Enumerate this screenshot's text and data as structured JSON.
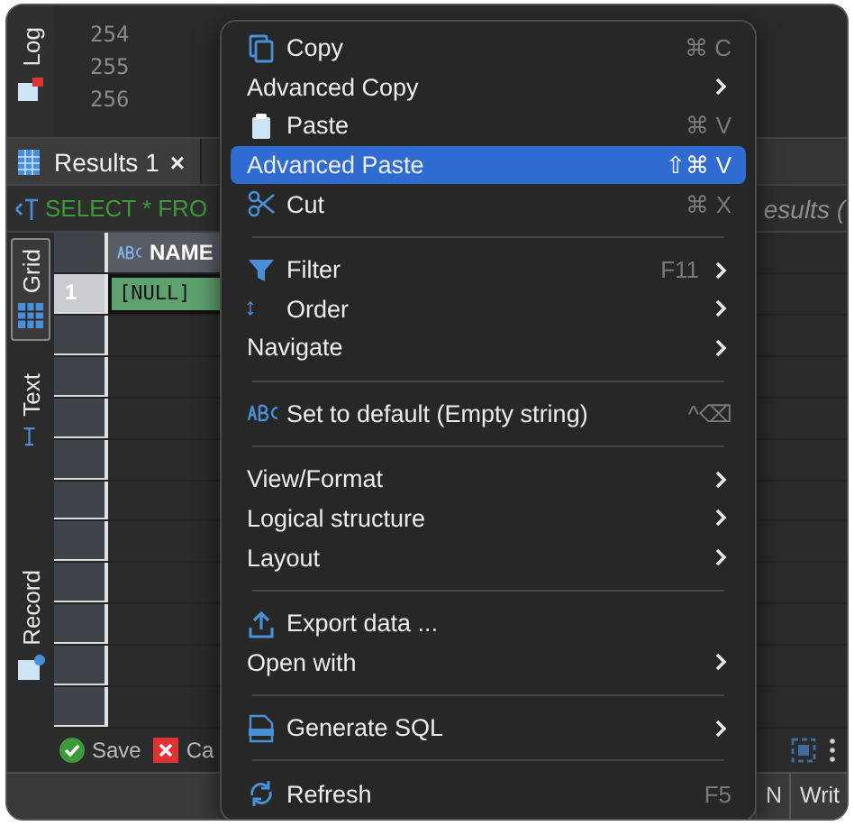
{
  "log_tab": {
    "label": "Log"
  },
  "editor": {
    "line_numbers": [
      "254",
      "255",
      "256"
    ]
  },
  "results_tab": {
    "label": "Results 1",
    "close": "×"
  },
  "query_bar": {
    "query": "SELECT * FRO",
    "hint": "esults ("
  },
  "view_tabs": [
    {
      "label": "Grid",
      "selected": true,
      "kind": "grid"
    },
    {
      "label": "Text",
      "selected": false,
      "kind": "text"
    },
    {
      "label": "Record",
      "selected": false,
      "kind": "record"
    }
  ],
  "grid": {
    "columns": [
      "NAME"
    ],
    "rows": [
      {
        "number": "1",
        "cells": [
          "[NULL]"
        ],
        "selected": true
      }
    ]
  },
  "toolbar": {
    "buttons": [
      {
        "label": "Save",
        "kind": "save"
      },
      {
        "label": "Ca",
        "kind": "cancel"
      }
    ]
  },
  "status_bar": {
    "items": [
      "N",
      "Writ"
    ]
  },
  "context_menu": {
    "items": [
      {
        "kind": "copy",
        "label": "Copy",
        "shortcut": "⌘ C",
        "submenu": false,
        "selected": false
      },
      {
        "kind": "plain",
        "label": "Advanced Copy",
        "submenu": true,
        "selected": false
      },
      {
        "kind": "paste",
        "label": "Paste",
        "shortcut": "⌘ V",
        "submenu": false,
        "selected": false
      },
      {
        "kind": "plain",
        "label": "Advanced Paste",
        "shortcut": "⇧⌘ V",
        "submenu": false,
        "selected": true
      },
      {
        "kind": "cut",
        "label": "Cut",
        "shortcut": "⌘ X",
        "submenu": false,
        "selected": false
      },
      {
        "kind": "separator"
      },
      {
        "kind": "filter",
        "label": "Filter",
        "shortcut": "F11",
        "submenu": true,
        "selected": false
      },
      {
        "kind": "order",
        "label": "Order",
        "submenu": true,
        "selected": false
      },
      {
        "kind": "plain",
        "label": "Navigate",
        "submenu": true,
        "selected": false
      },
      {
        "kind": "separator"
      },
      {
        "kind": "abc",
        "label": "Set to default (Empty string)",
        "shortcut": "^⌫",
        "submenu": false,
        "selected": false
      },
      {
        "kind": "separator"
      },
      {
        "kind": "plain",
        "label": "View/Format",
        "submenu": true,
        "selected": false
      },
      {
        "kind": "plain",
        "label": "Logical structure",
        "submenu": true,
        "selected": false
      },
      {
        "kind": "plain",
        "label": "Layout",
        "submenu": true,
        "selected": false
      },
      {
        "kind": "separator"
      },
      {
        "kind": "export",
        "label": "Export data ...",
        "submenu": false,
        "selected": false
      },
      {
        "kind": "plain",
        "label": "Open with",
        "submenu": true,
        "selected": false
      },
      {
        "kind": "separator"
      },
      {
        "kind": "sql",
        "label": "Generate SQL",
        "submenu": true,
        "selected": false
      },
      {
        "kind": "separator"
      },
      {
        "kind": "refresh",
        "label": "Refresh",
        "shortcut": "F5",
        "submenu": false,
        "selected": false
      }
    ]
  }
}
